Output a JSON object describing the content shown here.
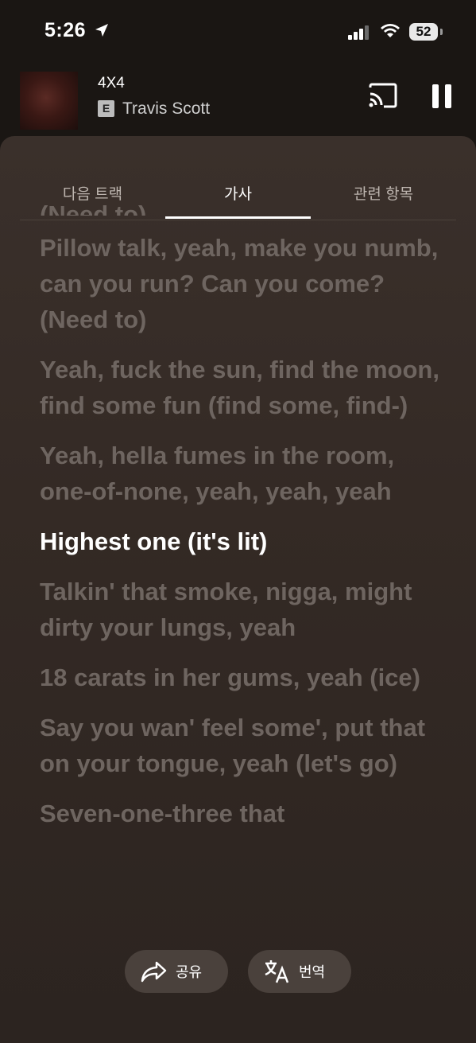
{
  "status_bar": {
    "time": "5:26",
    "battery": "52"
  },
  "now_playing": {
    "title": "4X4",
    "explicit_badge": "E",
    "artist": "Travis Scott"
  },
  "tabs": [
    {
      "label": "다음 트랙",
      "active": false
    },
    {
      "label": "가사",
      "active": true
    },
    {
      "label": "관련 항목",
      "active": false
    }
  ],
  "lyrics": {
    "lines": [
      "(Need to)",
      "Pillow talk, yeah, make you numb, can you run? Can you come? (Need to)",
      "Yeah, fuck the sun, find the moon, find some fun (find some, find-)",
      "Yeah, hella fumes in the room, one-of-none, yeah, yeah, yeah",
      "Highest one (it's lit)",
      "Talkin' that smoke, nigga, might dirty your lungs, yeah",
      "18 carats in her gums, yeah (ice)",
      "Say you wan' feel some', put that on your tongue, yeah (let's go)",
      "Seven-one-three that"
    ],
    "active_index": 4
  },
  "actions": {
    "share_label": "공유",
    "translate_label": "번역"
  },
  "icons": [
    "location-arrow-icon",
    "signal-icon",
    "wifi-icon",
    "battery-icon",
    "cast-icon",
    "pause-icon",
    "share-icon",
    "translate-icon"
  ]
}
